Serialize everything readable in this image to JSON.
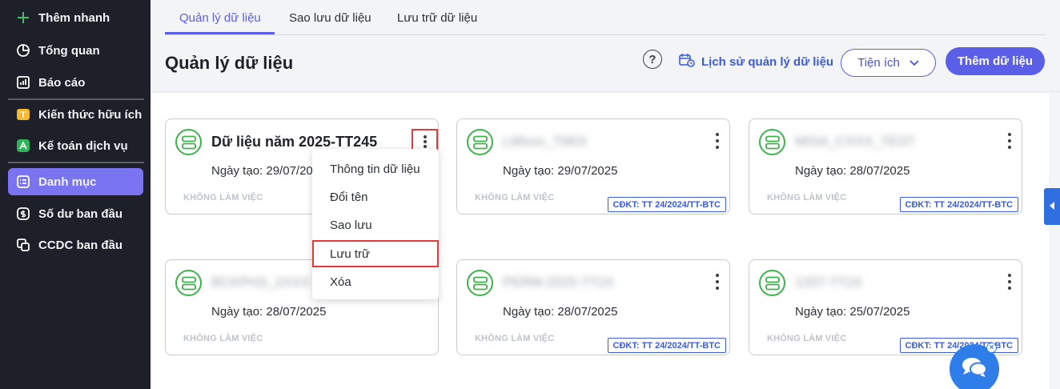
{
  "sidebar": {
    "items": [
      {
        "label": "Thêm nhanh",
        "icon": "plus-icon"
      },
      {
        "label": "Tổng quan",
        "icon": "pie-chart-icon"
      },
      {
        "label": "Báo cáo",
        "icon": "report-chart-icon"
      },
      {
        "label": "Kiến thức hữu ích",
        "icon": "knowledge-book-icon"
      },
      {
        "label": "Kế toán dịch vụ",
        "icon": "accounting-service-icon"
      },
      {
        "label": "Danh mục",
        "icon": "category-list-icon"
      },
      {
        "label": "Số dư ban đầu",
        "icon": "opening-balance-icon"
      },
      {
        "label": "CCDC ban đầu",
        "icon": "tools-equipment-icon"
      }
    ],
    "active": "Danh mục"
  },
  "tabs": [
    {
      "label": "Quản lý dữ liệu",
      "active": true
    },
    {
      "label": "Sao lưu dữ liệu",
      "active": false
    },
    {
      "label": "Lưu trữ dữ liệu",
      "active": false
    }
  ],
  "header": {
    "title": "Quản lý dữ liệu",
    "help": "?",
    "history_link": "Lịch sử quản lý dữ liệu",
    "utility_button": "Tiện ích",
    "add_button": "Thêm dữ liệu"
  },
  "cards": [
    {
      "name": "Dữ liệu năm 2025-TT245",
      "blurred": false,
      "date": "Ngày tạo: 29/07/2025",
      "status": "KHÔNG LÀM VIỆC",
      "badge": ""
    },
    {
      "name": "LMixxx_TMOI",
      "blurred": true,
      "date": "Ngày tạo: 29/07/2025",
      "status": "KHÔNG LÀM VIỆC",
      "badge": "CĐKT: TT 24/2024/TT-BTC"
    },
    {
      "name": "MISA_CXXX_TEST",
      "blurred": true,
      "date": "Ngày tạo: 28/07/2025",
      "status": "KHÔNG LÀM VIỆC",
      "badge": "CĐKT: TT 24/2024/TT-BTC"
    },
    {
      "name": "BCKPHS_2XXX",
      "blurred": true,
      "date": "Ngày tạo: 28/07/2025",
      "status": "KHÔNG LÀM VIỆC",
      "badge": ""
    },
    {
      "name": "PERM-2025-TT24",
      "blurred": true,
      "date": "Ngày tạo: 28/07/2025",
      "status": "KHÔNG LÀM VIỆC",
      "badge": "CĐKT: TT 24/2024/TT-BTC"
    },
    {
      "name": "1207-TT24",
      "blurred": true,
      "date": "Ngày tạo: 25/07/2025",
      "status": "KHÔNG LÀM VIỆC",
      "badge": "CĐKT: TT 24/2024/TT-BTC"
    }
  ],
  "context_menu": {
    "items": [
      "Thông tin dữ liệu",
      "Đổi tên",
      "Sao lưu",
      "Lưu trữ",
      "Xóa"
    ],
    "highlighted": "Lưu trữ"
  },
  "chat": {
    "close": "×"
  },
  "colors": {
    "accent": "#5b5ee6",
    "sidebar_bg": "#1d2028",
    "sidebar_active": "#7b74f0",
    "db_icon": "#3cb34a",
    "highlight": "#e03a3a",
    "badge": "#3b5bd8"
  }
}
